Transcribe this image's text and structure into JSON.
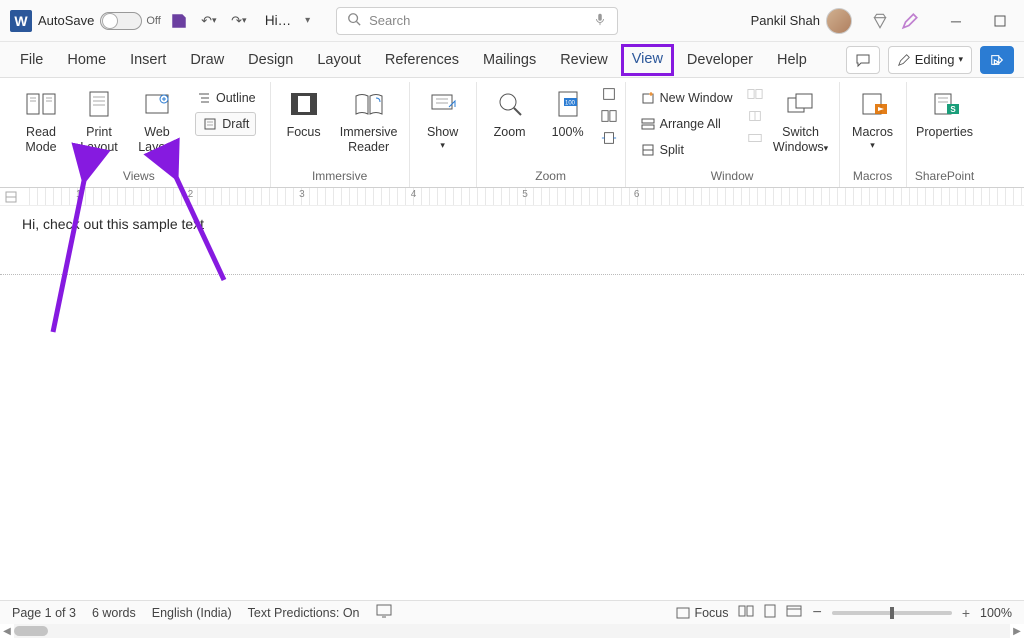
{
  "titlebar": {
    "autosave_label": "AutoSave",
    "autosave_state": "Off",
    "doc_short": "Hi…",
    "search_placeholder": "Search",
    "username": "Pankil Shah"
  },
  "tabs": {
    "file": "File",
    "home": "Home",
    "insert": "Insert",
    "draw": "Draw",
    "design": "Design",
    "layout": "Layout",
    "references": "References",
    "mailings": "Mailings",
    "review": "Review",
    "view": "View",
    "developer": "Developer",
    "help": "Help",
    "editing": "Editing"
  },
  "ribbon": {
    "views": {
      "read_mode": "Read Mode",
      "print_layout": "Print Layout",
      "web_layout": "Web Layout",
      "outline": "Outline",
      "draft": "Draft",
      "group": "Views"
    },
    "immersive": {
      "focus": "Focus",
      "immersive_reader": "Immersive Reader",
      "group": "Immersive"
    },
    "showzoom": {
      "show": "Show",
      "zoom": "Zoom",
      "hundred": "100%",
      "group_zoom": "Zoom"
    },
    "window": {
      "new_window": "New Window",
      "arrange_all": "Arrange All",
      "split": "Split",
      "switch_windows": "Switch Windows",
      "group": "Window"
    },
    "macros": {
      "macros": "Macros",
      "group": "Macros"
    },
    "sharepoint": {
      "properties": "Properties",
      "group": "SharePoint"
    }
  },
  "ruler_numbers": [
    "1",
    "2",
    "3",
    "4",
    "5",
    "6"
  ],
  "document": {
    "text": "Hi, check out this sample text"
  },
  "statusbar": {
    "page": "Page 1 of 3",
    "words": "6 words",
    "language": "English (India)",
    "predictions": "Text Predictions: On",
    "focus": "Focus",
    "zoom": "100%"
  },
  "annotation": {
    "color": "#861ae0"
  }
}
